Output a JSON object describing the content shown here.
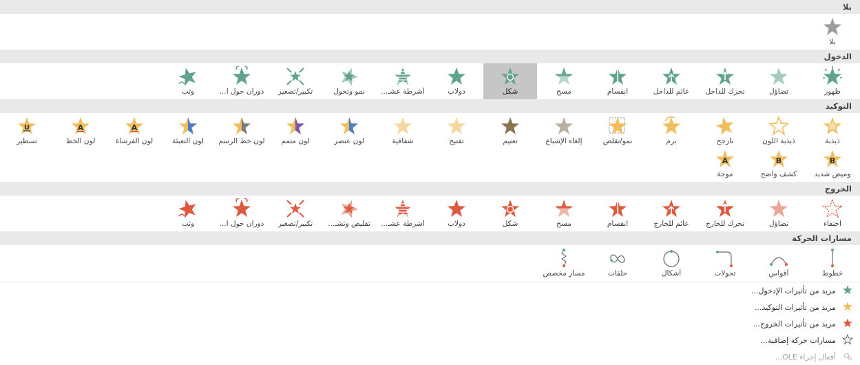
{
  "colors": {
    "entrance": "#5fa38a",
    "emphasis": "#f2bd5c",
    "exit": "#dd5940",
    "none": "#9c9c9c",
    "path": "#6a6a6a",
    "header_bg": "#e9e9e9",
    "selected_bg": "#c6c6c6"
  },
  "sections": {
    "none": {
      "title": "بلا",
      "items": [
        {
          "label": "بلا",
          "icon": "none-star-icon"
        }
      ]
    },
    "entrance": {
      "title": "الدخول",
      "items": [
        {
          "label": "ظهور",
          "icon": "appear-star-icon"
        },
        {
          "label": "تضاؤل",
          "icon": "fade-star-icon"
        },
        {
          "label": "تحرك للداخل",
          "icon": "fly-in-star-icon"
        },
        {
          "label": "عائم للداخل",
          "icon": "float-in-star-icon"
        },
        {
          "label": "انقسام",
          "icon": "split-star-icon"
        },
        {
          "label": "مسح",
          "icon": "wipe-star-icon"
        },
        {
          "label": "شكل",
          "icon": "shape-star-icon",
          "selected": true
        },
        {
          "label": "دولاب",
          "icon": "wheel-star-icon"
        },
        {
          "label": "أشرطة عشـ...",
          "icon": "random-bars-star-icon"
        },
        {
          "label": "نمو وتحول",
          "icon": "grow-turn-star-icon"
        },
        {
          "label": "تكبير/تصغير",
          "icon": "zoom-star-icon"
        },
        {
          "label": "دوران حول ا...",
          "icon": "swivel-star-icon"
        },
        {
          "label": "وثب",
          "icon": "bounce-star-icon"
        }
      ]
    },
    "emphasis": {
      "title": "التوكيد",
      "items": [
        {
          "label": "ذبذبة",
          "icon": "pulse-star-icon"
        },
        {
          "label": "ذبذبة اللون",
          "icon": "color-pulse-star-icon"
        },
        {
          "label": "تأرجح",
          "icon": "teeter-star-icon"
        },
        {
          "label": "برم",
          "icon": "spin-star-icon"
        },
        {
          "label": "نمو/تقلص",
          "icon": "grow-shrink-star-icon"
        },
        {
          "label": "إلغاء الإشباع",
          "icon": "desaturate-star-icon"
        },
        {
          "label": "تعتيم",
          "icon": "darken-star-icon"
        },
        {
          "label": "تفتيح",
          "icon": "lighten-star-icon"
        },
        {
          "label": "شفافية",
          "icon": "transparency-star-icon"
        },
        {
          "label": "لون عنصر",
          "icon": "object-color-star-icon"
        },
        {
          "label": "لون متمم",
          "icon": "complementary-color-star-icon"
        },
        {
          "label": "لون خط الرسم",
          "icon": "line-color-star-icon"
        },
        {
          "label": "لون التعبئة",
          "icon": "fill-color-star-icon"
        },
        {
          "label": "لون الفرشاة",
          "icon": "brush-color-star-icon"
        },
        {
          "label": "لون الخط",
          "icon": "font-color-star-icon"
        },
        {
          "label": "تسطير",
          "icon": "underline-star-icon"
        },
        {
          "label": "وميض شديد",
          "icon": "bold-flash-star-icon"
        },
        {
          "label": "كشف واضح",
          "icon": "bold-reveal-star-icon"
        },
        {
          "label": "موجة",
          "icon": "wave-star-icon"
        }
      ]
    },
    "exit": {
      "title": "الخروج",
      "items": [
        {
          "label": "اختفاء",
          "icon": "disappear-star-icon"
        },
        {
          "label": "تضاؤل",
          "icon": "fade-out-star-icon"
        },
        {
          "label": "تحرك للخارج",
          "icon": "fly-out-star-icon"
        },
        {
          "label": "عائم للخارج",
          "icon": "float-out-star-icon"
        },
        {
          "label": "انقسام",
          "icon": "split-out-star-icon"
        },
        {
          "label": "مسح",
          "icon": "wipe-out-star-icon"
        },
        {
          "label": "شكل",
          "icon": "shape-out-star-icon"
        },
        {
          "label": "دولاب",
          "icon": "wheel-out-star-icon"
        },
        {
          "label": "أشرطة عشـ...",
          "icon": "random-bars-out-star-icon"
        },
        {
          "label": "تقليص وتشـ...",
          "icon": "shrink-turn-star-icon"
        },
        {
          "label": "تكبير/تصغير",
          "icon": "zoom-out-star-icon"
        },
        {
          "label": "دوران حول ا...",
          "icon": "swivel-out-star-icon"
        },
        {
          "label": "وثب",
          "icon": "bounce-out-star-icon"
        }
      ]
    },
    "motion": {
      "title": "مسارات الحركة",
      "items": [
        {
          "label": "خطوط",
          "icon": "lines-path-icon"
        },
        {
          "label": "أقواس",
          "icon": "arcs-path-icon"
        },
        {
          "label": "تحولات",
          "icon": "turns-path-icon"
        },
        {
          "label": "أشكال",
          "icon": "shapes-path-icon"
        },
        {
          "label": "حلقات",
          "icon": "loops-path-icon"
        },
        {
          "label": "مسار مخصص",
          "icon": "custom-path-icon"
        }
      ]
    }
  },
  "more": [
    {
      "label": "مزيد من تأثيرات الإدخول...",
      "icon": "entrance-more-icon",
      "enabled": true
    },
    {
      "label": "مزيد من تأثيرات التوكيد...",
      "icon": "emphasis-more-icon",
      "enabled": true
    },
    {
      "label": "مزيد من تأثيرات الخروج...",
      "icon": "exit-more-icon",
      "enabled": true
    },
    {
      "label": "مسارات حركة إضافية...",
      "icon": "motion-more-icon",
      "enabled": true
    },
    {
      "label": "أفعال إجراء OLE...",
      "icon": "ole-actions-icon",
      "enabled": false
    }
  ]
}
